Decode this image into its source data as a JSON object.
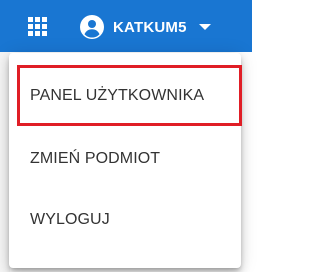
{
  "header": {
    "username": "KATKUM5",
    "apps_icon": "apps-grid-icon",
    "avatar_icon": "account-circle-icon",
    "caret_icon": "arrow-drop-down-icon",
    "background_color": "#1976d2"
  },
  "menu": {
    "items": [
      {
        "label": "PANEL UŻYTKOWNIKA",
        "highlighted": true
      },
      {
        "label": "ZMIEŃ PODMIOT"
      },
      {
        "label": "WYLOGUJ"
      }
    ],
    "highlight_color": "#e01e26"
  }
}
